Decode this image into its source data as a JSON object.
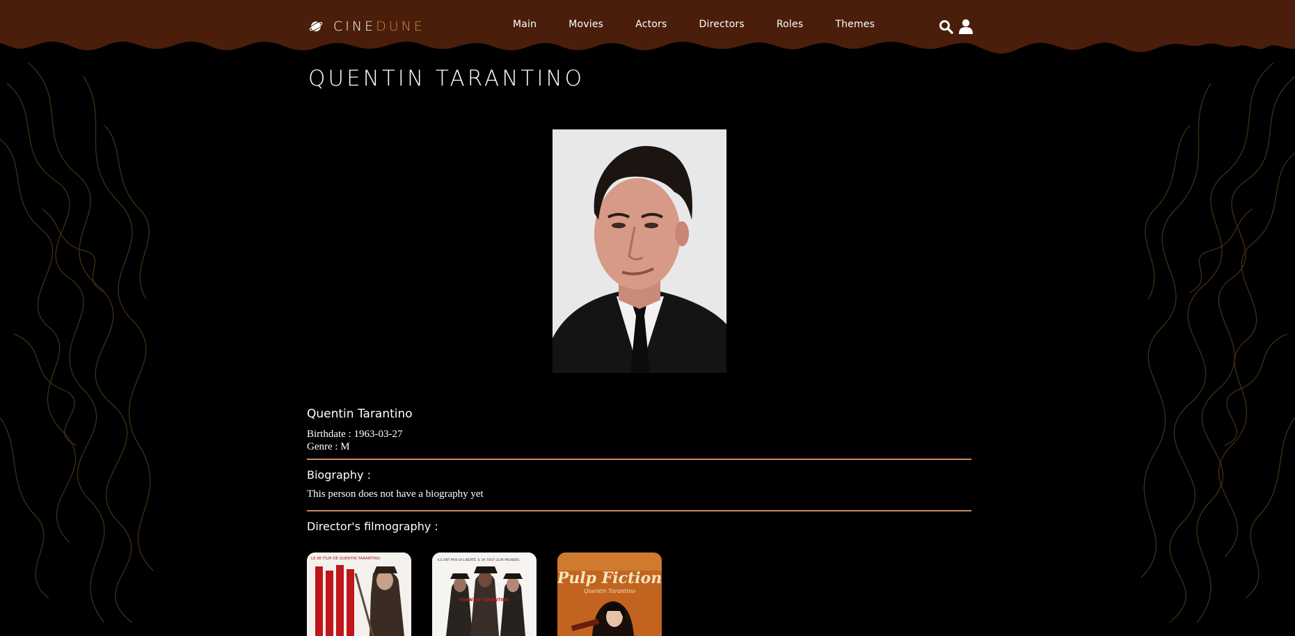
{
  "brand": {
    "name_part1": "CINE",
    "name_part2": "DUNE",
    "accent": "#c98a4a",
    "header_color": "#4a1e0a"
  },
  "nav": {
    "items": [
      "Main",
      "Movies",
      "Actors",
      "Directors",
      "Roles",
      "Themes"
    ]
  },
  "icons": {
    "search": "search-icon",
    "user": "user-icon",
    "logo": "planet-icon"
  },
  "page": {
    "title": "Quentin Tarantino"
  },
  "person": {
    "name": "Quentin Tarantino",
    "birthdate_line": "Birthdate : 1963-03-27",
    "genre_line": "Genre : M"
  },
  "biography": {
    "heading": "Biography :",
    "text": "This person does not have a biography yet"
  },
  "filmography": {
    "heading": "Director's filmography :",
    "films": [
      {
        "poster_top_text": "LE 8E FILM DE QUENTIN TARANTINO"
      },
      {
        "poster_top_text": "ILS ONT PRIS SA LIBERTÉ. IL VA TOUT LEUR PRENDRE.",
        "poster_credit": "QUENTIN TARANTINO"
      },
      {
        "poster_title": "Pulp Fiction",
        "poster_credit": "Quentin Tarantino"
      }
    ]
  }
}
